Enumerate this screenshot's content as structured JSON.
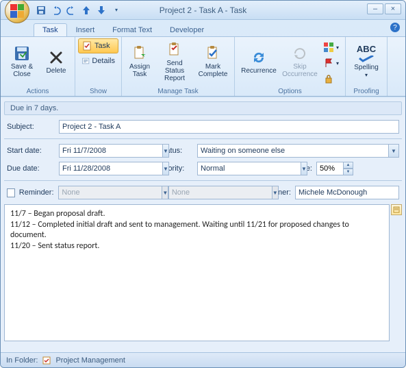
{
  "window": {
    "title": "Project 2 - Task A - Task"
  },
  "qat": {
    "save": "save",
    "undo": "undo",
    "redo": "redo",
    "prev": "prev",
    "next": "next"
  },
  "tabs": [
    "Task",
    "Insert",
    "Format Text",
    "Developer"
  ],
  "ribbon": {
    "actions": {
      "label": "Actions",
      "save_close": "Save & Close",
      "delete": "Delete"
    },
    "show": {
      "label": "Show",
      "task": "Task",
      "details": "Details"
    },
    "manage": {
      "label": "Manage Task",
      "assign": "Assign Task",
      "send": "Send Status Report",
      "mark": "Mark Complete"
    },
    "options": {
      "label": "Options",
      "recurrence": "Recurrence",
      "skip": "Skip Occurrence",
      "categorize": "",
      "followup": "",
      "private": ""
    },
    "proofing": {
      "label": "Proofing",
      "spelling": "Spelling"
    }
  },
  "info_bar": "Due in 7 days.",
  "form": {
    "subject_label": "Subject:",
    "subject": "Project 2 - Task A",
    "start_label": "Start date:",
    "start": "Fri 11/7/2008",
    "due_label": "Due date:",
    "due": "Fri 11/28/2008",
    "status_label": "Status:",
    "status": "Waiting on someone else",
    "priority_label": "Priority:",
    "priority": "Normal",
    "complete_label": "% Complete:",
    "complete": "50%",
    "reminder_label": "Reminder:",
    "reminder_date": "None",
    "reminder_time": "None",
    "owner_label": "Owner:",
    "owner": "Michele McDonough"
  },
  "notes": "11/7 – Began proposal draft.\n11/12 – Completed initial draft and sent to management. Waiting until 11/21 for proposed changes to document.\n11/20 – Sent status report.",
  "status": {
    "in_folder_label": "In Folder:",
    "folder": "Project Management"
  }
}
